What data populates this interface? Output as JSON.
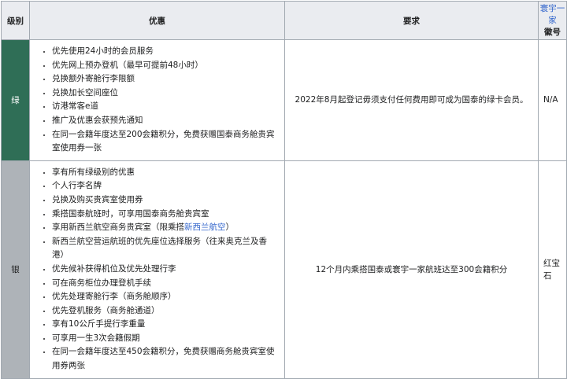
{
  "table": {
    "headers": {
      "level": "级别",
      "benefits": "优惠",
      "requirements": "要求",
      "alliance_link": "寰宇一家",
      "badge_suffix": "徽号"
    },
    "rows": [
      {
        "level": "绿",
        "benefits": [
          "优先使用24小时的会员服务",
          "优先网上预办登机（最早可提前48小时）",
          "兑换额外寄舱行李限额",
          "兑换加长空间座位",
          "访港常客e道",
          "推广及优惠会获预先通知",
          "在同一会籍年度达至200会籍积分，免费获赠国泰商务舱贵宾室使用券一张"
        ],
        "requirement": "2022年8月起登记毋须支付任何费用即可成为国泰的绿卡会员。",
        "badge": "N/A"
      },
      {
        "level": "银",
        "benefits": [
          "享有所有绿级别的优惠",
          "个人行李名牌",
          "兑换及购买贵宾室使用券",
          "乘搭国泰航班时，可享用国泰商务舱贵宾室",
          "享用新西兰航空商务贵宾室（限乘搭",
          "新西兰航空营运航班的优先座位选择服务（往来奥克兰及香港）",
          "优先候补获得机位及优先处理行李",
          "可在商务柜位办理登机手续",
          "优先处理寄舱行李（商务舱顺序）",
          "优先登机服务（商务舱通道）",
          "享有10公斤手提行李重量",
          "可享用一生3次会籍假期",
          "在同一会籍年度达至450会籍积分，免费获赠商务舱贵宾室使用券两张"
        ],
        "benefit_link": "新西兰航空",
        "benefit_link_tail": "）",
        "requirement": "12个月内乘搭国泰或寰宇一家航班达至300会籍积分",
        "badge": "红宝石"
      }
    ]
  },
  "colors": {
    "green_level_bg": "#2f6e56",
    "silver_level_bg": "#aeb3b8",
    "link": "#3366cc"
  }
}
